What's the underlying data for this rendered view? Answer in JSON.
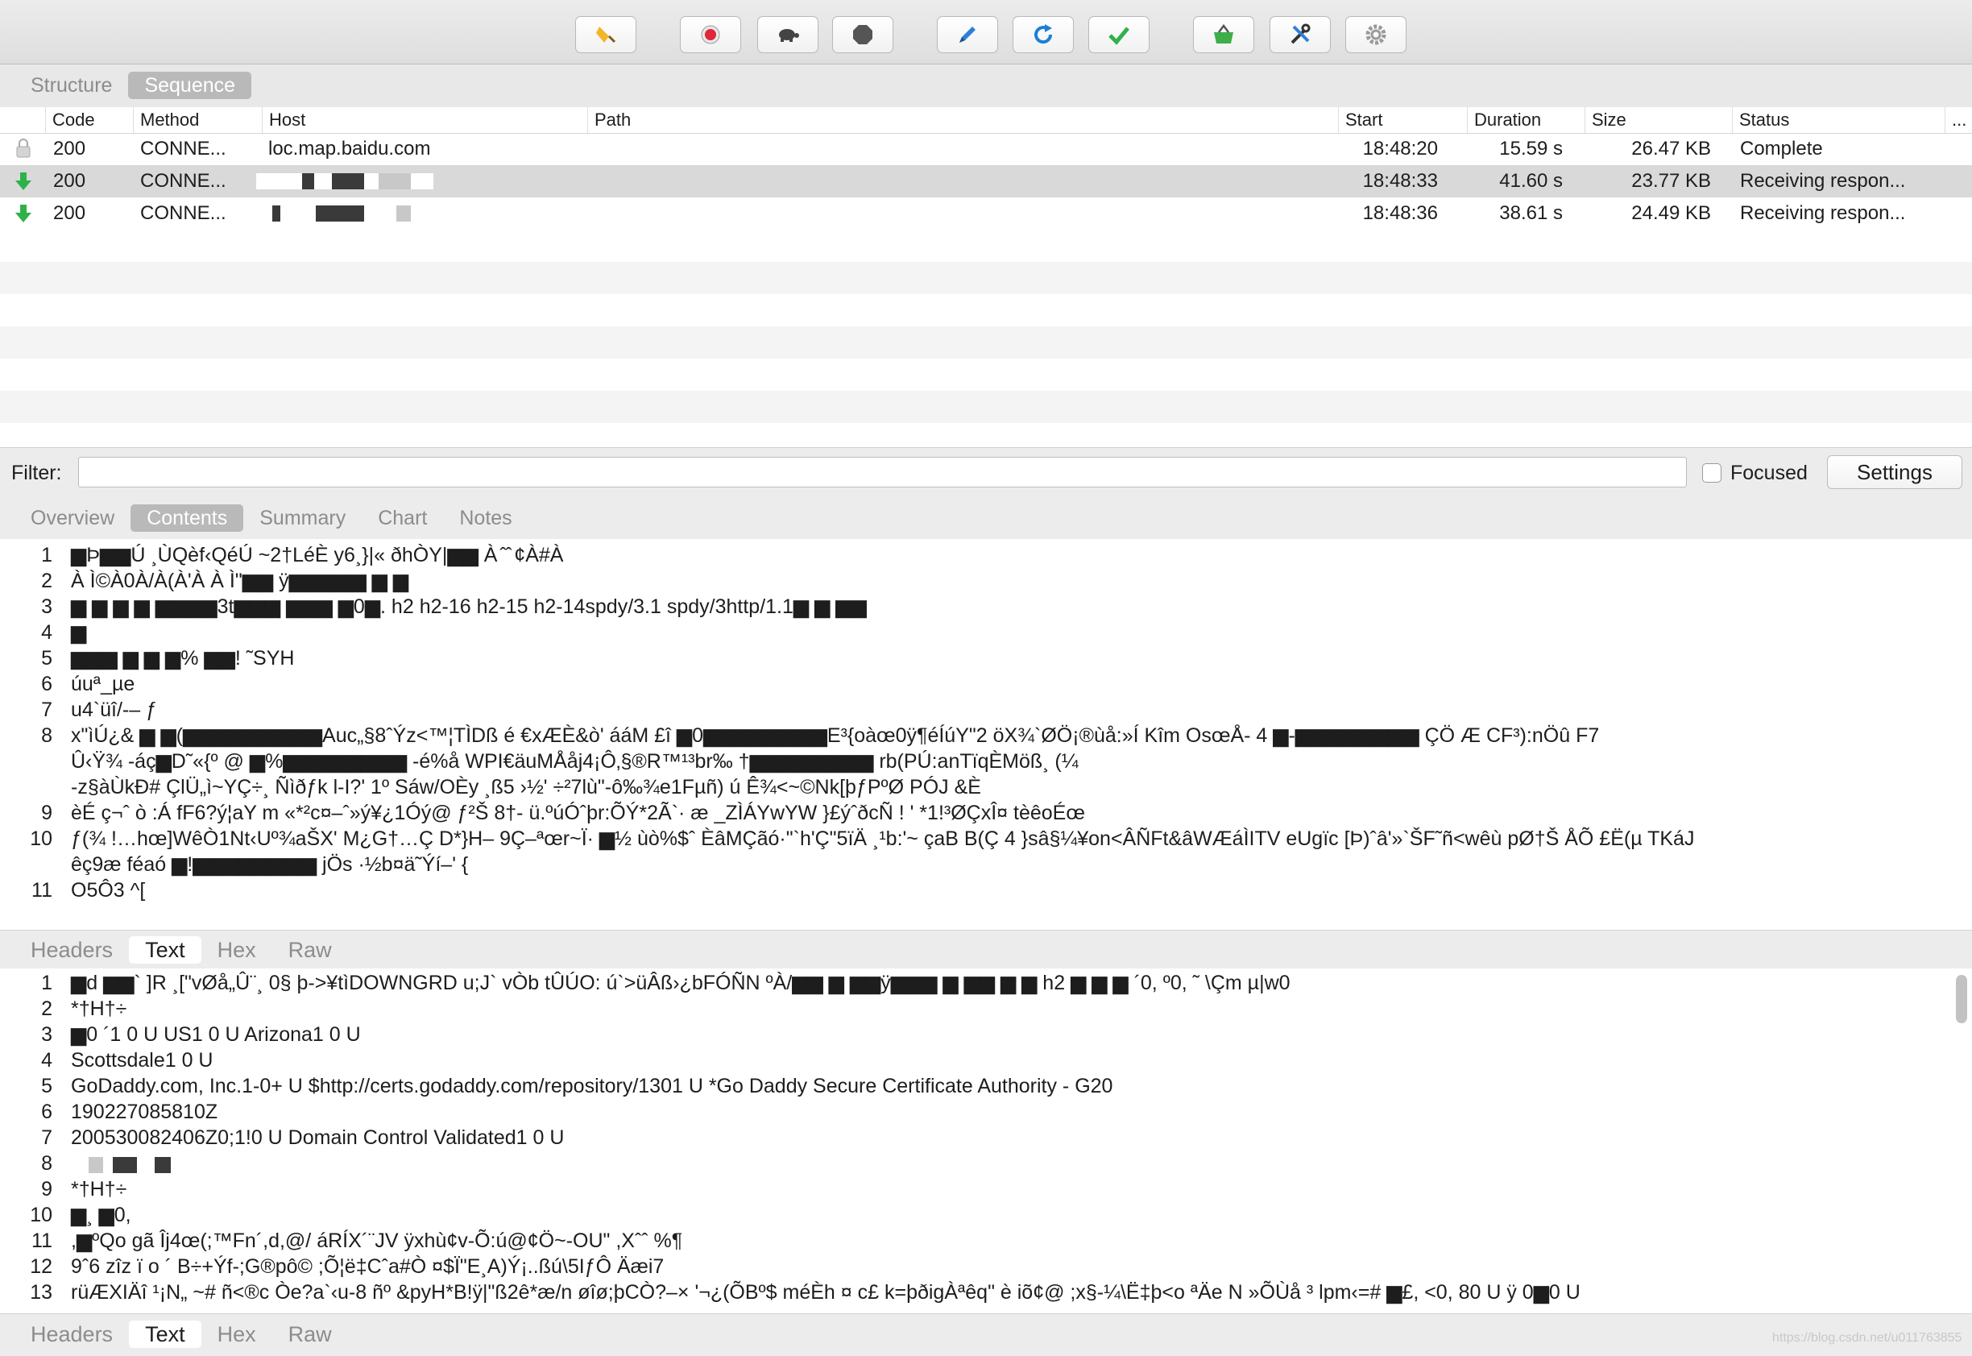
{
  "toolbar": {
    "buttons": [
      {
        "name": "clear-broom-icon"
      },
      {
        "name": "record-icon"
      },
      {
        "name": "throttle-turtle-icon"
      },
      {
        "name": "stop-breakpoint-icon"
      },
      {
        "name": "compose-pen-icon"
      },
      {
        "name": "refresh-icon"
      },
      {
        "name": "validate-check-icon"
      },
      {
        "name": "shopping-basket-icon"
      },
      {
        "name": "tools-icon"
      },
      {
        "name": "gear-icon"
      }
    ]
  },
  "view_tabs": {
    "structure": "Structure",
    "sequence": "Sequence"
  },
  "table": {
    "headers": {
      "code": "Code",
      "method": "Method",
      "host": "Host",
      "path": "Path",
      "start": "Start",
      "duration": "Duration",
      "size": "Size",
      "status": "Status",
      "more": "..."
    },
    "rows": [
      {
        "code": "200",
        "method": "CONNE...",
        "host": "loc.map.baidu.com",
        "start": "18:48:20",
        "duration": "15.59 s",
        "size": "26.47 KB",
        "status": "Complete",
        "icon": "lock-icon"
      },
      {
        "code": "200",
        "method": "CONNE...",
        "host": "",
        "start": "18:48:33",
        "duration": "41.60 s",
        "size": "23.77 KB",
        "status": "Receiving respon...",
        "icon": "download-arrow-icon"
      },
      {
        "code": "200",
        "method": "CONNE...",
        "host": "",
        "start": "18:48:36",
        "duration": "38.61 s",
        "size": "24.49 KB",
        "status": "Receiving respon...",
        "icon": "download-arrow-icon"
      }
    ]
  },
  "filter": {
    "label": "Filter:",
    "value": "",
    "focused_label": "Focused",
    "settings_label": "Settings"
  },
  "detail_tabs": {
    "overview": "Overview",
    "contents": "Contents",
    "summary": "Summary",
    "chart": "Chart",
    "notes": "Notes"
  },
  "request_body": {
    "lines": [
      {
        "n": "1",
        "text": " ▆Þ▆▆Ú  ¸ÙQèf‹QéÚ  ~2†LéÈ y6¸}|« ðhÒY|▆▆ À  ̂ ̂ ¢À#À"
      },
      {
        "n": "2",
        "text": "À              Ì©À0À/À(À'À À Ì\"▆▆ ÿ▆▆▆▆▆ ▆ ▆"
      },
      {
        "n": "3",
        "text": "▆ ▆             ▆ ▆ ▆▆▆▆3t▆▆▆ ▆▆▆ ▆0▆. h2 h2-16 h2-15 h2-14spdy/3.1 spdy/3http/1.1▆ ▆ ▆▆"
      },
      {
        "n": "4",
        "text": "▆"
      },
      {
        "n": "5",
        "text": "▆▆▆ ▆ ▆     ▆% ▆▆! ˜SYH"
      },
      {
        "n": "6",
        "text": " úuª_µe"
      },
      {
        "n": "7",
        "text": "u4`üî/-– ƒ"
      },
      {
        "n": "8",
        "text": "x\"ìÚ¿&   ▆   ▆(▆▆▆▆▆▆▆▆▆Auc„§8ˆÝz<™¦TÌDß  é €xÆÈ&ò' ááM  £î    ▆0▆▆▆▆▆▆▆▆E³{oàœ0ÿ¶éÍúY\"2  öX¾`ØÖ¡®ùå:»Í  Kîm OsœÅ- 4    ▆-▆▆▆▆▆▆▆▆  ÇÖ     Æ CF³):nÖû F7"
      },
      {
        "n": "",
        "text": "Û‹Ÿ¾ -áç▆D˜«{º @      ▆%▆▆▆▆▆▆▆▆ -é%å  WPI€äuMÅåj4¡Ô‚§®R™¹³br‰    †▆▆▆▆▆▆▆▆ rb(PÚ:anTïqÈMöß¸ (¼"
      },
      {
        "n": "",
        "text": " -z§àÙkÐ#  ÇlÜ„ì~YÇ÷¸ Ñìðƒk  l-I?' 1º Sáw/OÈy ¸ß5 ›½' ÷²7lù\"-ô‰¾e1Fµñ) ú Ê¾<~©Nk[þƒPºØ PÓJ &È"
      },
      {
        "n": "9",
        "text": "èÉ  ç¬ˆ ò :Á fF6?ý¦aY m  «*²c¤–ˆ»ý¥¿1Óý@   ƒ²Š 8†- ü.ºúÓˆþr:ÕÝ*2Ã`· æ _ZÌÁYwYW  }£ýˆðcÑ !   ' *1!³ØÇxÎ¤  tèêoÉœ"
      },
      {
        "n": "10",
        "text": "ƒ(¾ !…hœ]WêÒ1Nt‹Uº¾aŠX' M¿G†…Ç D*}H– 9Ç–ªœr~Ï· ▆½ ùò%$ˆ  ÈâMÇãó·\"`h'Ç\"5ïÄ    ¸¹b:'~   çaB  B(Ç 4 }sâ§¼¥on<ÂÑFt&âWÆáÌITV eUgïc [Þ)ˆâ'»`ŠF˜ñ<wêù pØ†Š  ÅÕ £Ë(µ TKáJ"
      },
      {
        "n": "",
        "text": "êç9æ féaó    ▆!▆▆▆▆▆▆▆▆  jÖs  ·½b¤ä˜Ýí–'  {"
      },
      {
        "n": "11",
        "text": "O5Ô3 ^["
      }
    ]
  },
  "body_tabs_top": {
    "headers": "Headers",
    "text": "Text",
    "hex": "Hex",
    "raw": "Raw"
  },
  "response_body": {
    "lines": [
      {
        "n": "1",
        "text": "  ▆d ▆▆`  ]R ¸[\"vØå„Û¨¸ 0§   þ->¥tìDOWNGRD u;J` vÒb tÛÚO:  ú`>üÂß›¿bFÓÑN  ºÀ/▆▆ ▆ ▆▆ÿ▆▆▆ ▆ ▆▆ ▆ ▆   h2       ▆  ▆  ▆ ´0, º0, ˜        \\Çm µ|w0"
      },
      {
        "n": "2",
        "text": "                 *†H†÷"
      },
      {
        "n": "3",
        "text": "  ▆0 ´1 0      U    US1 0    U    Arizona1 0    U"
      },
      {
        "n": "4",
        "text": "Scottsdale1 0    U"
      },
      {
        "n": "5",
        "text": "  GoDaddy.com, Inc.1-0+  U    $http://certs.godaddy.com/repository/1301  U    *Go Daddy Secure Certificate Authority - G20"
      },
      {
        "n": "6",
        "text": "190227085810Z"
      },
      {
        "n": "7",
        "text": "200530082406Z0;1!0    U     Domain Control Validated1 0    U"
      },
      {
        "n": "8",
        "text": ""
      },
      {
        "n": "9",
        "text": "                 *†H†÷"
      },
      {
        "n": "10",
        "text": " ▆¸ ▆0,"
      },
      {
        "n": "11",
        "text": " ,▆ºQo gã   Îj4œ(;™Fn´,d,@/  áRÍX´¨JV ÿxhù¢v-Õ:ú@¢Ö~-OU\"  ,Xˆˆ %¶"
      },
      {
        "n": "12",
        "text": "9ˆ6 zîz        ï  o  ´  B÷+Ýf-;G®pô© ;Õ¦ë‡Cˆa#Ò ¤$Ï\"E¸A)Ý¡..ßú\\5IƒÔ  Äæi7"
      },
      {
        "n": "13",
        "text": "rüÆXIÄî ¹¡N„  ~# ñ<®c  Òe?a`‹u-8 ñº &pyH*B!ÿ|\"ß2ê*æ/n øîø;þCÒ?–× '¬¿(ÕBº$  méÈh ¤ c£   k=þðigÀªêq\"  è  iõ¢@   ;x§-¼\\Ë‡þ<o ªÄe  N »ÕÙå  ³  lpm‹=#  ▆£, <0, 80   U ÿ  0▆0  U"
      }
    ]
  },
  "body_tabs_bottom": {
    "headers": "Headers",
    "text": "Text",
    "hex": "Hex",
    "raw": "Raw"
  },
  "watermark": "https://blog.csdn.net/u011763855"
}
